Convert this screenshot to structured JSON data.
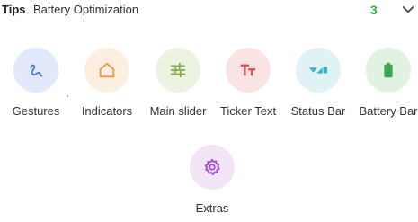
{
  "tips_bar": {
    "label": "Tips",
    "title": "Battery Optimization",
    "count": "3",
    "chevron_icon": "chevron-down-icon"
  },
  "tiles": [
    {
      "label": "Gestures",
      "icon": "gesture-icon",
      "bg": "#e1e9fb",
      "fg": "#4a78d8"
    },
    {
      "label": "Indicators",
      "icon": "home-outline-icon",
      "bg": "#fcefe1",
      "fg": "#e99a45"
    },
    {
      "label": "Main slider",
      "icon": "tune-icon",
      "bg": "#ecf3e0",
      "fg": "#86a84a"
    },
    {
      "label": "Ticker Text",
      "icon": "text-format-icon",
      "bg": "#fae4e4",
      "fg": "#e14d4d"
    },
    {
      "label": "Status Bar",
      "icon": "status-bar-icon",
      "bg": "#dff2f4",
      "fg": "#3db1c2"
    },
    {
      "label": "Battery Bar",
      "icon": "battery-icon",
      "bg": "#e2f1e2",
      "fg": "#3aa650"
    },
    {
      "label": "Extras",
      "icon": "gear-icon",
      "bg": "#f1e5f6",
      "fg": "#a14ed0"
    }
  ]
}
